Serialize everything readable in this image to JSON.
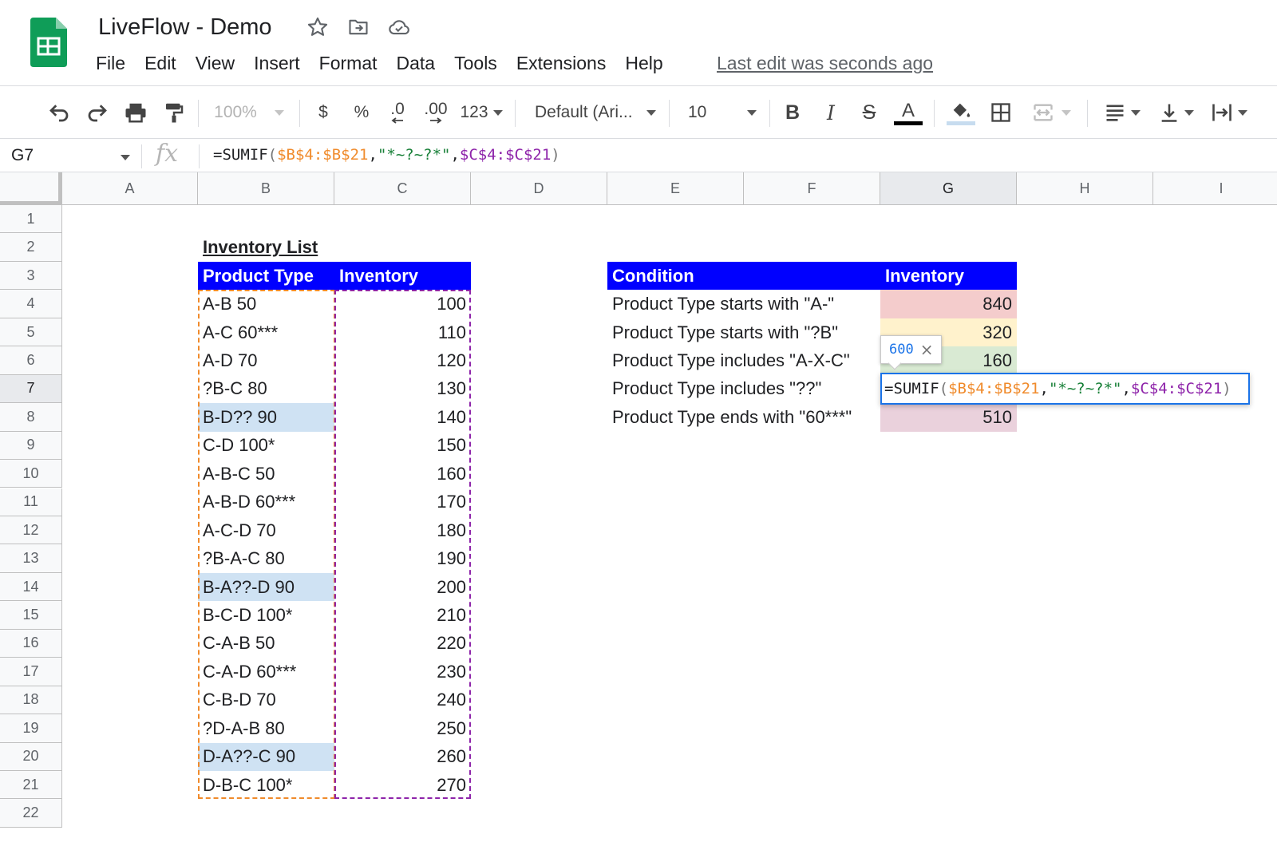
{
  "app": {
    "doc_title": "LiveFlow - Demo",
    "menu": [
      "File",
      "Edit",
      "View",
      "Insert",
      "Format",
      "Data",
      "Tools",
      "Extensions",
      "Help"
    ],
    "last_edit": "Last edit was seconds ago",
    "icons": [
      "sheets-logo-icon",
      "star-icon",
      "move-to-folder-icon",
      "cloud-saved-icon"
    ]
  },
  "toolbar": {
    "zoom": "100%",
    "currency": "$",
    "percent": "%",
    "decrease_decimal": ".0",
    "increase_decimal": ".00",
    "more_formats": "123",
    "font": "Default (Ari...",
    "font_size": "10",
    "bold": "B",
    "italic": "I",
    "strike": "S",
    "text_color": "A"
  },
  "formula_bar": {
    "name_box": "G7",
    "fx": "fx",
    "formula": {
      "eq": "=SUMIF",
      "open": "(",
      "range1": "$B$4:$B$21",
      "comma1": ",",
      "criterion": "\"*~?~?*\"",
      "comma2": ",",
      "range2": "$C$4:$C$21",
      "close": ")"
    }
  },
  "columns": [
    "A",
    "B",
    "C",
    "D",
    "E",
    "F",
    "G",
    "H",
    "I"
  ],
  "selected_column": "G",
  "rows": [
    "1",
    "2",
    "3",
    "4",
    "5",
    "6",
    "7",
    "8",
    "9",
    "10",
    "11",
    "12",
    "13",
    "14",
    "15",
    "16",
    "17",
    "18",
    "19",
    "20",
    "21",
    "22"
  ],
  "selected_row": "7",
  "inventory_list": {
    "title": "Inventory List",
    "header_product": "Product Type",
    "header_inventory": "Inventory",
    "items": [
      {
        "product": "A-B 50",
        "inventory": "100"
      },
      {
        "product": "A-C 60***",
        "inventory": "110"
      },
      {
        "product": "A-D 70",
        "inventory": "120"
      },
      {
        "product": "?B-C 80",
        "inventory": "130"
      },
      {
        "product": "B-D?? 90",
        "inventory": "140"
      },
      {
        "product": "C-D 100*",
        "inventory": "150"
      },
      {
        "product": "A-B-C 50",
        "inventory": "160"
      },
      {
        "product": "A-B-D 60***",
        "inventory": "170"
      },
      {
        "product": "A-C-D 70",
        "inventory": "180"
      },
      {
        "product": "?B-A-C 80",
        "inventory": "190"
      },
      {
        "product": "B-A??-D 90",
        "inventory": "200"
      },
      {
        "product": "B-C-D 100*",
        "inventory": "210"
      },
      {
        "product": "C-A-B 50",
        "inventory": "220"
      },
      {
        "product": "C-A-D 60***",
        "inventory": "230"
      },
      {
        "product": "C-B-D 70",
        "inventory": "240"
      },
      {
        "product": "?D-A-B 80",
        "inventory": "250"
      },
      {
        "product": "D-A??-C 90",
        "inventory": "260"
      },
      {
        "product": "D-B-C 100*",
        "inventory": "270"
      }
    ],
    "highlight_color": "#cfe2f3"
  },
  "conditions": {
    "header_condition": "Condition",
    "header_inventory": "Inventory",
    "items": [
      {
        "condition": "Product Type starts with \"A-\"",
        "result": "840",
        "color": "#f4cccc"
      },
      {
        "condition": "Product Type starts with \"?B\"",
        "result": "320",
        "color": "#fff2cc"
      },
      {
        "condition": "Product Type includes \"A-X-C\"",
        "result": "160",
        "color": "#d9ead3"
      },
      {
        "condition": "Product Type includes \"??\"",
        "result": "",
        "color": "#ffffff"
      },
      {
        "condition": "Product Type ends with \"60***\"",
        "result": "510",
        "color": "#ead1dc"
      }
    ]
  },
  "editor": {
    "tooltip_value": "600",
    "tooltip_close": "×"
  },
  "colors": {
    "header_blue": "#0000ff",
    "range1": "#f08b2c",
    "range2": "#8e24aa",
    "selection": "#1a73e8"
  }
}
